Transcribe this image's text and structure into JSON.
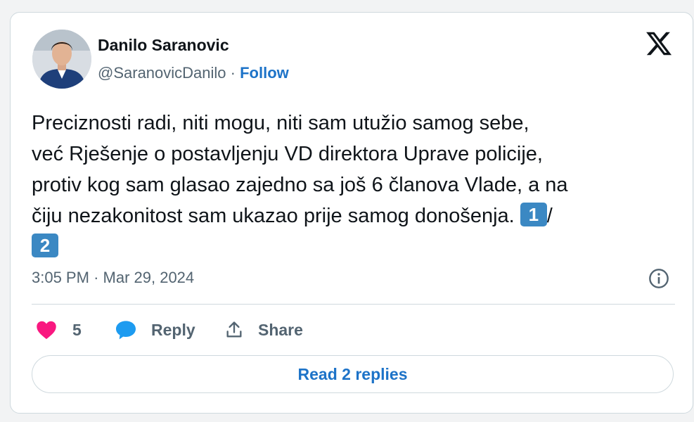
{
  "author": {
    "name": "Danilo Saranovic",
    "handle": "@SaranovicDanilo",
    "separator": "·",
    "follow_label": "Follow"
  },
  "tweet": {
    "text_1": "Preciznosti radi, niti mogu, niti sam utužio samog sebe,",
    "text_2": "već Rješenje o postavljenju VD direktora Uprave policije,",
    "text_3": "protiv kog sam glasao zajedno sa još 6 članova Vlade, a na",
    "text_4": "čiju nezakonitost sam ukazao prije samog donošenja.",
    "keycap_1": "1",
    "slash": "/",
    "keycap_2": "2"
  },
  "meta": {
    "time": "3:05 PM",
    "separator": "·",
    "date": "Mar 29, 2024"
  },
  "actions": {
    "like_count": "5",
    "reply_label": "Reply",
    "share_label": "Share"
  },
  "replies_button_label": "Read 2 replies",
  "colors": {
    "accent": "#1d73c8",
    "like": "#f91880",
    "reply": "#1d9bf0",
    "keycap": "#3b88c3"
  },
  "icons": {
    "logo": "x-logo-icon",
    "info": "info-icon",
    "like": "heart-icon",
    "reply": "speech-bubble-icon",
    "share": "share-icon"
  }
}
